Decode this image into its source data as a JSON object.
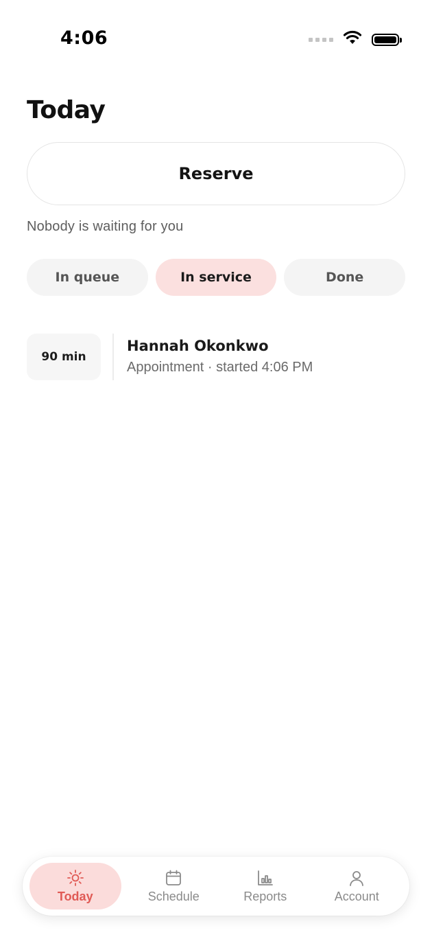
{
  "status_bar": {
    "time": "4:06",
    "icons": [
      "signal-icon",
      "wifi-icon",
      "battery-icon"
    ]
  },
  "header": {
    "title": "Today"
  },
  "actions": {
    "reserve_label": "Reserve"
  },
  "queue": {
    "status_text": "Nobody is waiting for you"
  },
  "filters": {
    "tabs": [
      {
        "label": "In queue",
        "active": false
      },
      {
        "label": "In service",
        "active": true
      },
      {
        "label": "Done",
        "active": false
      }
    ]
  },
  "in_service": {
    "items": [
      {
        "duration": "90 min",
        "name": "Hannah Okonkwo",
        "details": "Appointment · started 4:06 PM"
      }
    ]
  },
  "bottom_nav": {
    "items": [
      {
        "label": "Today",
        "icon": "sun-icon",
        "active": true
      },
      {
        "label": "Schedule",
        "icon": "calendar-icon",
        "active": false
      },
      {
        "label": "Reports",
        "icon": "bar-chart-icon",
        "active": false
      },
      {
        "label": "Account",
        "icon": "person-icon",
        "active": false
      }
    ]
  },
  "colors": {
    "accent": "#e05a55",
    "accent_bg": "#fbdcdb",
    "chip_bg": "#f4f4f4"
  }
}
